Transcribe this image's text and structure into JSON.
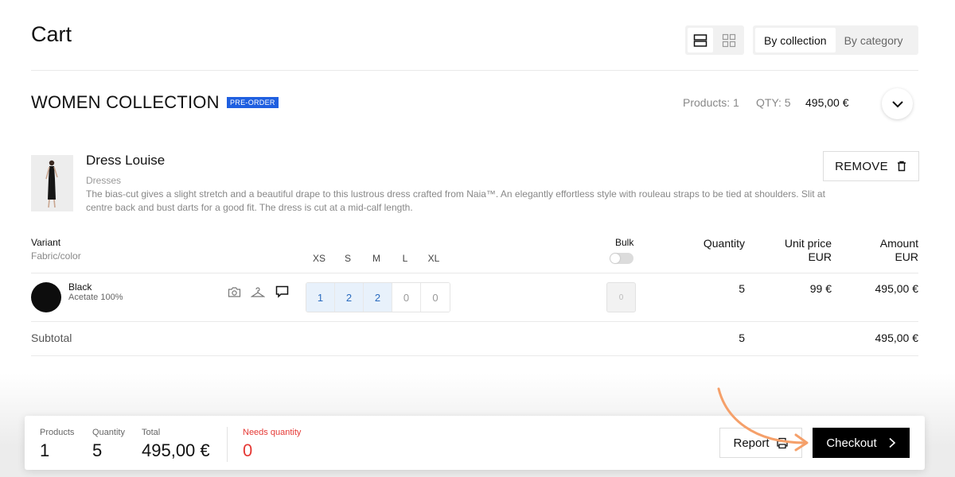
{
  "header": {
    "title": "Cart",
    "group_options": [
      "By collection",
      "By category"
    ],
    "active_group": "By collection"
  },
  "collection": {
    "title": "WOMEN COLLECTION",
    "badge": "PRE-ORDER",
    "products_label": "Products: 1",
    "qty_label": "QTY: 5",
    "total": "495,00 €"
  },
  "product": {
    "name": "Dress Louise",
    "category": "Dresses",
    "description": "The bias-cut gives a slight stretch and a beautiful drape to this lustrous dress crafted from Naia™. An elegantly effortless style with rouleau straps to be tied at shoulders. Slit at centre back and bust darts for a good fit. The dress is cut at a mid-calf length.",
    "remove_label": "REMOVE"
  },
  "table": {
    "variant_header": "Variant",
    "variant_sub": "Fabric/color",
    "sizes": [
      "XS",
      "S",
      "M",
      "L",
      "XL"
    ],
    "bulk_header": "Bulk",
    "bulk_enabled": false,
    "quantity_header": "Quantity",
    "unit_price_header": "Unit price",
    "unit_price_sub": "EUR",
    "amount_header": "Amount",
    "amount_sub": "EUR"
  },
  "variant": {
    "color": "Black",
    "fabric": "Acetate 100%",
    "swatch_color": "#0d0d0d",
    "size_qty": [
      "1",
      "2",
      "2",
      "0",
      "0"
    ],
    "bulk_value": "0",
    "quantity": "5",
    "unit_price": "99 €",
    "amount": "495,00 €"
  },
  "subtotal": {
    "label": "Subtotal",
    "quantity": "5",
    "amount": "495,00 €"
  },
  "footer": {
    "products_label": "Products",
    "products_value": "1",
    "quantity_label": "Quantity",
    "quantity_value": "5",
    "total_label": "Total",
    "total_value": "495,00 €",
    "needs_label": "Needs quantity",
    "needs_value": "0",
    "report_label": "Report",
    "checkout_label": "Checkout"
  },
  "colors": {
    "badge": "#1f5fe0",
    "needs": "#e53935",
    "qty_filled_bg": "#e8f1fb",
    "qty_filled_text": "#2a6bbf",
    "checkout_bg": "#000000",
    "annotation_arrow": "#f5a06a"
  },
  "icons": {
    "view_list": "rows-icon",
    "view_grid": "grid-icon",
    "collapse": "chevron-down-icon",
    "remove": "trash-icon",
    "photo": "camera-icon",
    "hanger": "hanger-icon",
    "comment": "comment-icon",
    "report": "printer-icon",
    "checkout": "chevron-right-icon"
  }
}
